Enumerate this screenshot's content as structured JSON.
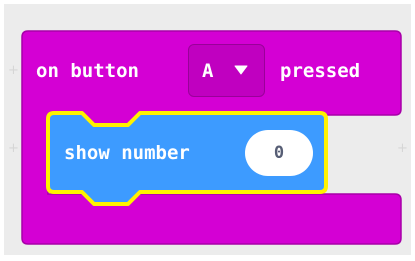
{
  "event_block": {
    "on_label": "on button",
    "button_value": "A",
    "pressed_label": "pressed",
    "color": "#d400d4",
    "border_color": "#a800a8"
  },
  "show_number_block": {
    "label": "show number",
    "value": "0",
    "color": "#3d9bff",
    "highlight_color": "#fff200"
  },
  "icons": {
    "dropdown": "caret-down-icon",
    "grid": "plus-icon"
  }
}
